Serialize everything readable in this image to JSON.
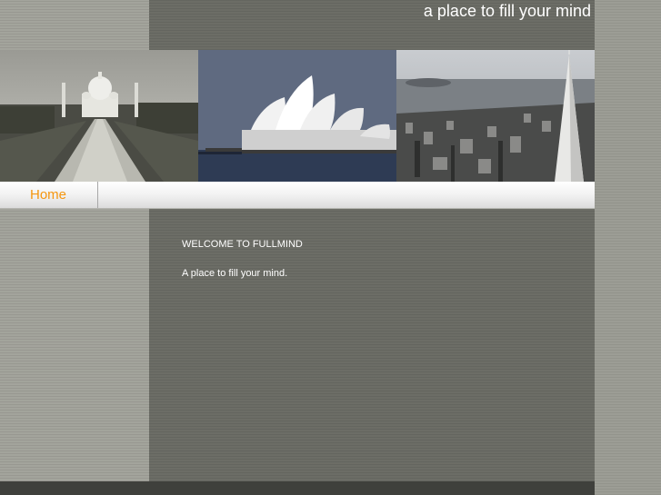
{
  "header": {
    "tagline": "a place to fill your mind"
  },
  "banner": {
    "images": [
      {
        "name": "taj-mahal-photo"
      },
      {
        "name": "sydney-opera-house-photo"
      },
      {
        "name": "san-francisco-photo"
      }
    ]
  },
  "nav": {
    "home_label": "Home",
    "accent_color": "#f5960f"
  },
  "main": {
    "heading": "WELCOME TO FULLMIND",
    "intro": "A place to fill your mind."
  },
  "colors": {
    "page_bg": "#9c9d95",
    "panel_bg": "#6c6d66",
    "footer_bg": "#3f403c"
  }
}
